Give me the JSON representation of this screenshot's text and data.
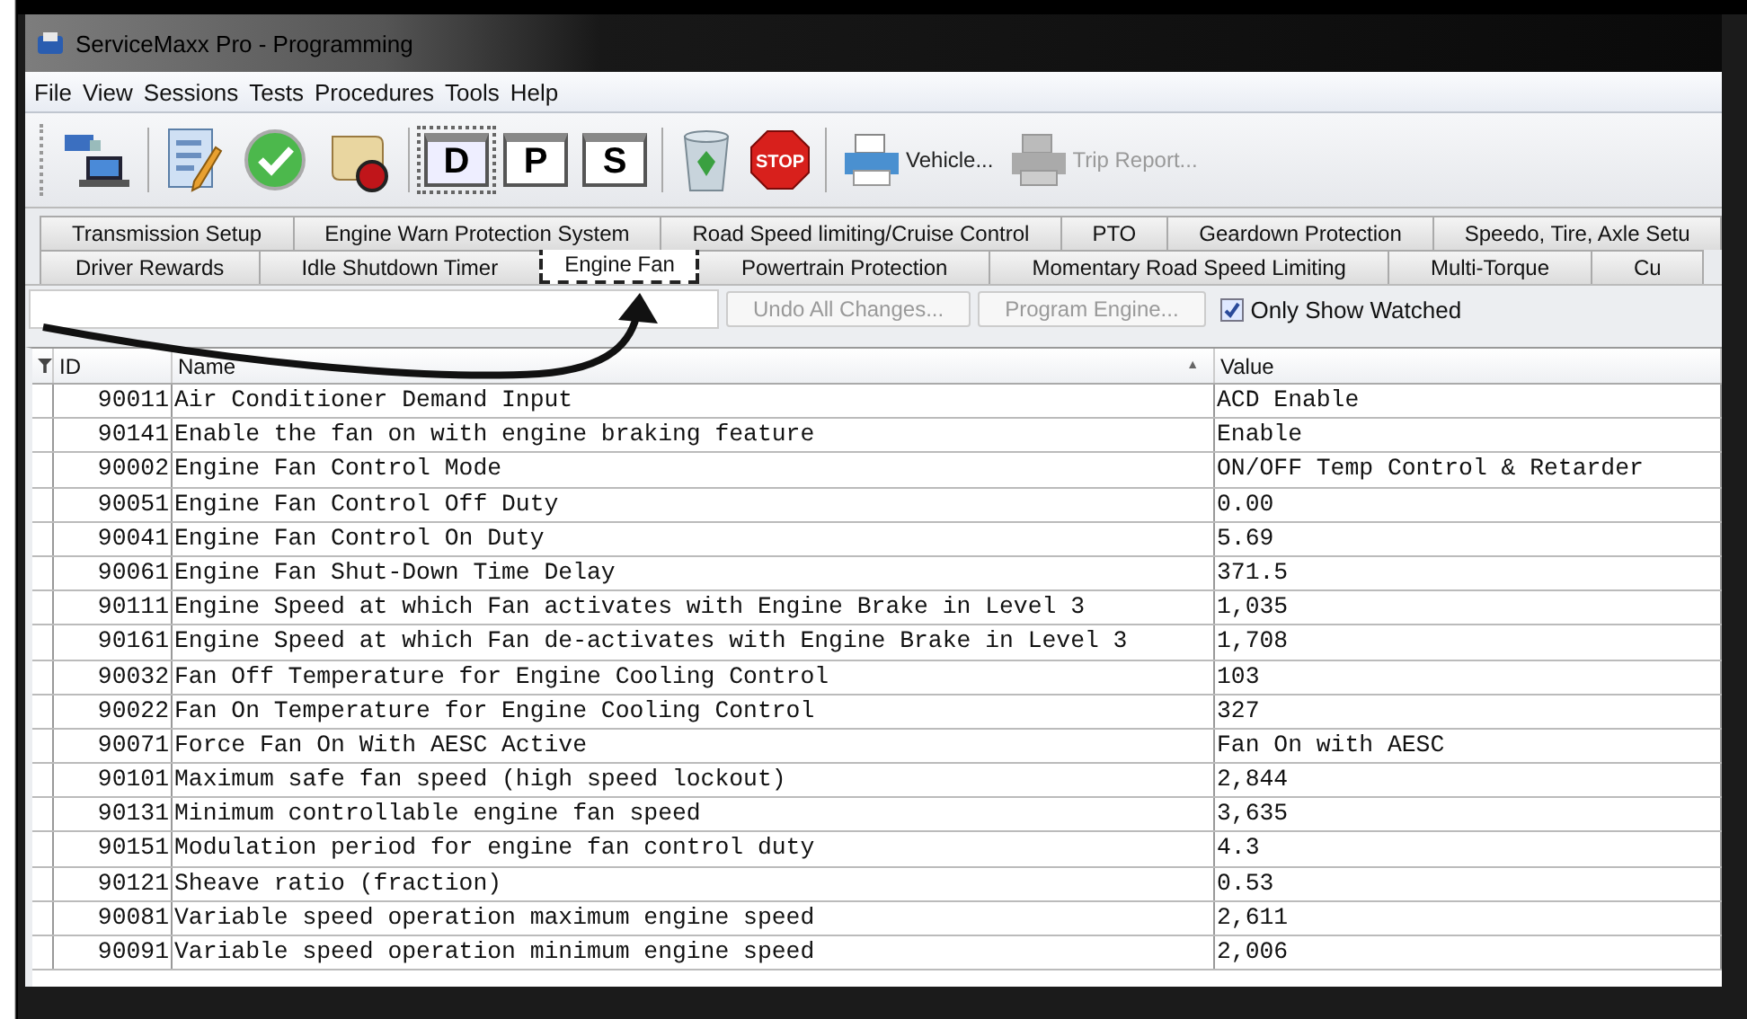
{
  "window": {
    "title": "ServiceMaxx Pro - Programming"
  },
  "menu": [
    "File",
    "View",
    "Sessions",
    "Tests",
    "Procedures",
    "Tools",
    "Help"
  ],
  "toolbar": [
    {
      "kind": "connect"
    },
    {
      "kind": "edit"
    },
    {
      "kind": "check"
    },
    {
      "kind": "scroll"
    },
    {
      "kind": "letter",
      "label": "D",
      "selected": true
    },
    {
      "kind": "letter",
      "label": "P",
      "selected": false
    },
    {
      "kind": "letter",
      "label": "S",
      "selected": false
    },
    {
      "kind": "trash"
    },
    {
      "kind": "stop",
      "label": "STOP"
    },
    {
      "kind": "printer",
      "label": "Vehicle...",
      "disabled": false
    },
    {
      "kind": "printer",
      "label": "Trip Report...",
      "disabled": true
    }
  ],
  "tab_rows": [
    [
      {
        "label": "Transmission Setup",
        "selected": false
      },
      {
        "label": "Engine Warn Protection System",
        "selected": false
      },
      {
        "label": "Road Speed limiting/Cruise Control",
        "selected": false
      },
      {
        "label": "PTO",
        "selected": false
      },
      {
        "label": "Geardown Protection",
        "selected": false
      },
      {
        "label": "Speedo, Tire, Axle Setu",
        "selected": false
      }
    ],
    [
      {
        "label": "Driver Rewards",
        "selected": false
      },
      {
        "label": "Idle Shutdown Timer",
        "selected": false
      },
      {
        "label": "Engine Fan",
        "selected": true
      },
      {
        "label": "Powertrain Protection",
        "selected": false
      },
      {
        "label": "Momentary Road Speed Limiting",
        "selected": false
      },
      {
        "label": "Multi-Torque",
        "selected": false
      },
      {
        "label": "Cu",
        "selected": false
      }
    ]
  ],
  "actions": [
    {
      "label": "Undo All Changes...",
      "disabled": true
    },
    {
      "label": "Program Engine...",
      "disabled": true
    }
  ],
  "watch_checkbox": {
    "label": "Only Show Watched",
    "checked": true
  },
  "table": {
    "columns": [
      {
        "label": "ID"
      },
      {
        "label": "Name",
        "sort": "▲"
      },
      {
        "label": "Value"
      }
    ],
    "rows": [
      [
        "90011",
        "Air Conditioner Demand Input",
        "ACD Enable"
      ],
      [
        "90141",
        "Enable the fan on with engine braking feature",
        "Enable"
      ],
      [
        "90002",
        "Engine Fan Control Mode",
        "ON/OFF Temp Control & Retarder"
      ],
      [
        "90051",
        "Engine Fan Control Off Duty",
        "0.00"
      ],
      [
        "90041",
        "Engine Fan Control On Duty",
        "5.69"
      ],
      [
        "90061",
        "Engine Fan Shut-Down Time Delay",
        "371.5"
      ],
      [
        "90111",
        "Engine Speed at which Fan activates with Engine Brake in Level 3",
        "1,035"
      ],
      [
        "90161",
        "Engine Speed at which Fan de-activates with Engine Brake in Level 3",
        "1,708"
      ],
      [
        "90032",
        "Fan Off Temperature for Engine Cooling Control",
        "103"
      ],
      [
        "90022",
        "Fan On Temperature for Engine Cooling Control",
        "327"
      ],
      [
        "90071",
        "Force Fan On With AESC Active",
        "Fan On with AESC"
      ],
      [
        "90101",
        "Maximum safe fan speed (high speed lockout)",
        "2,844"
      ],
      [
        "90131",
        "Minimum controllable engine fan speed",
        "3,635"
      ],
      [
        "90151",
        "Modulation period for engine fan control duty",
        "4.3"
      ],
      [
        "90121",
        "Sheave ratio (fraction)",
        "0.53"
      ],
      [
        "90081",
        "Variable speed operation maximum engine speed",
        "2,611"
      ],
      [
        "90091",
        "Variable speed operation minimum engine speed",
        "2,006"
      ]
    ]
  }
}
